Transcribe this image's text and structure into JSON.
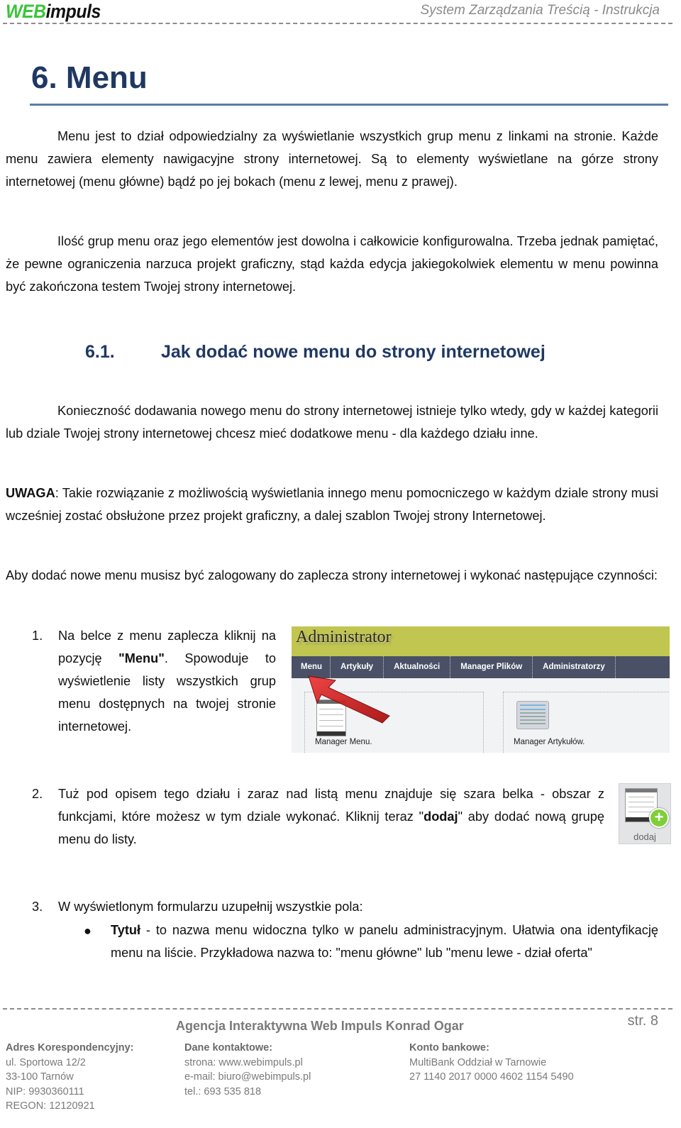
{
  "header": {
    "logo_web": "WEB",
    "logo_impuls": "impuls",
    "doc_title": "System Zarządzania Treścią - Instrukcja"
  },
  "chapter": {
    "title": "6. Menu",
    "intro_p1": "Menu jest to dział odpowiedzialny za wyświetlanie wszystkich grup menu z linkami na stronie. Każde menu zawiera elementy nawigacyjne strony internetowej. Są to elementy wyświetlane na górze strony internetowej (menu główne) bądź po jej bokach (menu z lewej, menu z prawej).",
    "intro_p2": "Ilość grup menu oraz jego elementów jest dowolna i całkowicie konfigurowalna. Trzeba jednak pamiętać, że pewne ograniczenia narzuca projekt graficzny, stąd każda edycja jakiegokolwiek elementu w menu powinna być zakończona testem Twojej strony internetowej."
  },
  "section": {
    "number": "6.1.",
    "title": "Jak dodać nowe menu do strony internetowej",
    "p1": "Konieczność dodawania nowego menu do strony internetowej istnieje tylko wtedy, gdy w każdej kategorii lub dziale Twojej strony internetowej chcesz mieć dodatkowe menu - dla każdego działu inne.",
    "warning_label": "UWAGA",
    "warning_text": ": Takie rozwiązanie z możliwością wyświetlania innego menu pomocniczego w każdym dziale strony musi wcześniej zostać obsłużone przez projekt graficzny, a dalej szablon Twojej strony Internetowej.",
    "p3": "Aby dodać nowe menu musisz być zalogowany do zaplecza strony internetowej i wykonać następujące czynności:"
  },
  "steps": [
    {
      "number": "1.",
      "text_before": "Na belce z menu zaplecza kliknij na pozycję ",
      "bold": "\"Menu\"",
      "text_after": ". Spowoduje to wyświetlenie listy wszystkich grup menu dostępnych na twojej stronie internetowej."
    },
    {
      "number": "2.",
      "text_before": "Tuż pod opisem tego działu i zaraz nad listą menu znajduje się szara belka - obszar z funkcjami, które możesz w tym dziale wykonać. Kliknij teraz \"",
      "bold": "dodaj",
      "text_after": "\" aby dodać nową grupę menu do listy."
    },
    {
      "number": "3.",
      "text": "W wyświetlonym formularzu uzupełnij wszystkie pola:",
      "bullets": [
        {
          "bold": "Tytuł",
          "text": " - to nazwa menu widoczna tylko w panelu administracyjnym. Ułatwia ona identyfikację menu na liście. Przykładowa nazwa to: \"menu główne\" lub  \"menu lewe -  dział oferta\""
        }
      ]
    }
  ],
  "admin_screenshot": {
    "brand": "Administrator",
    "nav": [
      "Menu",
      "Artykuły",
      "Aktualności",
      "Manager Plików",
      "Administratorzy"
    ],
    "cards": [
      "Manager Menu.",
      "Manager Artykułów."
    ],
    "colors": {
      "top": "#c1c651",
      "nav": "#4a5166",
      "arrow": "#d21f1f"
    }
  },
  "dodaj_icon": {
    "label": "dodaj",
    "plus": "+"
  },
  "footer": {
    "agency": "Agencja Interaktywna Web Impuls Konrad Ogar",
    "page": "str. 8",
    "address": {
      "title": "Adres Korespondencyjny:",
      "lines": [
        "ul. Sportowa 12/2",
        "33-100 Tarnów",
        "NIP: 9930360111",
        "REGON: 12120921"
      ]
    },
    "contact": {
      "title": "Dane kontaktowe:",
      "lines": [
        "strona: www.webimpuls.pl",
        "e-mail: biuro@webimpuls.pl",
        "tel.: 693 535 818"
      ]
    },
    "bank": {
      "title": "Konto bankowe:",
      "lines": [
        "MultiBank Oddział w Tarnowie",
        "27 1140 2017 0000 4602 1154 5490"
      ]
    }
  }
}
